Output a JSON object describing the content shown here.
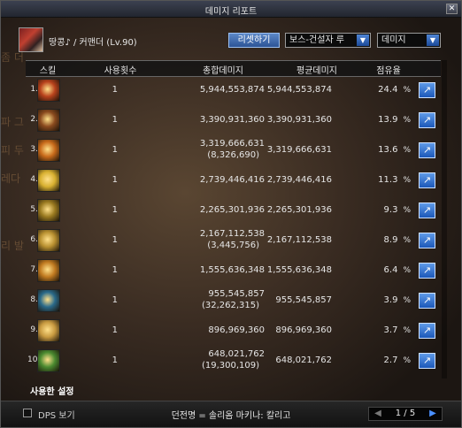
{
  "window": {
    "title": "데미지 리포트"
  },
  "header": {
    "character": "땅콩♪ / 커맨더 (Lv.90)",
    "reset_label": "리셋하기",
    "target_select": "보스-건설자 루",
    "metric_select": "데미지"
  },
  "table": {
    "columns": [
      "스킬",
      "사용횟수",
      "총합데미지",
      "평균데미지",
      "점유율"
    ],
    "rows": [
      {
        "rank": "1.",
        "count": "1",
        "total": "5,944,553,874",
        "sub": "",
        "avg": "5,944,553,874",
        "pct": "24.4",
        "icon_color": "#b8421c"
      },
      {
        "rank": "2.",
        "count": "1",
        "total": "3,390,931,360",
        "sub": "",
        "avg": "3,390,931,360",
        "pct": "13.9",
        "icon_color": "#8a4a1e"
      },
      {
        "rank": "3.",
        "count": "1",
        "total": "3,319,666,631",
        "sub": "(8,326,690)",
        "avg": "3,319,666,631",
        "pct": "13.6",
        "icon_color": "#c86a1a"
      },
      {
        "rank": "4.",
        "count": "1",
        "total": "2,739,446,416",
        "sub": "",
        "avg": "2,739,446,416",
        "pct": "11.3",
        "icon_color": "#d8b030"
      },
      {
        "rank": "5.",
        "count": "1",
        "total": "2,265,301,936",
        "sub": "",
        "avg": "2,265,301,936",
        "pct": "9.3",
        "icon_color": "#9a7a20"
      },
      {
        "rank": "6.",
        "count": "1",
        "total": "2,167,112,538",
        "sub": "(3,445,756)",
        "avg": "2,167,112,538",
        "pct": "8.9",
        "icon_color": "#b89030"
      },
      {
        "rank": "7.",
        "count": "1",
        "total": "1,555,636,348",
        "sub": "",
        "avg": "1,555,636,348",
        "pct": "6.4",
        "icon_color": "#c07a20"
      },
      {
        "rank": "8.",
        "count": "1",
        "total": "955,545,857",
        "sub": "(32,262,315)",
        "avg": "955,545,857",
        "pct": "3.9",
        "icon_color": "#2a6a8a"
      },
      {
        "rank": "9.",
        "count": "1",
        "total": "896,969,360",
        "sub": "",
        "avg": "896,969,360",
        "pct": "3.7",
        "icon_color": "#c89a40"
      },
      {
        "rank": "10.",
        "count": "1",
        "total": "648,021,762",
        "sub": "(19,300,109)",
        "avg": "648,021,762",
        "pct": "2.7",
        "icon_color": "#4a8a30"
      }
    ],
    "pct_unit": "%"
  },
  "used_set_label": "사용한 설정",
  "footer": {
    "dps_label": "DPS 보기",
    "dungeon": "던전명 = 솔리옴 마키나: 칼리고",
    "page": "1 / 5"
  },
  "colors": {
    "accent": "#2f62b8",
    "share": "#3a7ad6"
  },
  "icons": {
    "close": "close-icon",
    "prev": "prev-page-icon",
    "next": "next-page-icon",
    "share": "share-icon"
  }
}
